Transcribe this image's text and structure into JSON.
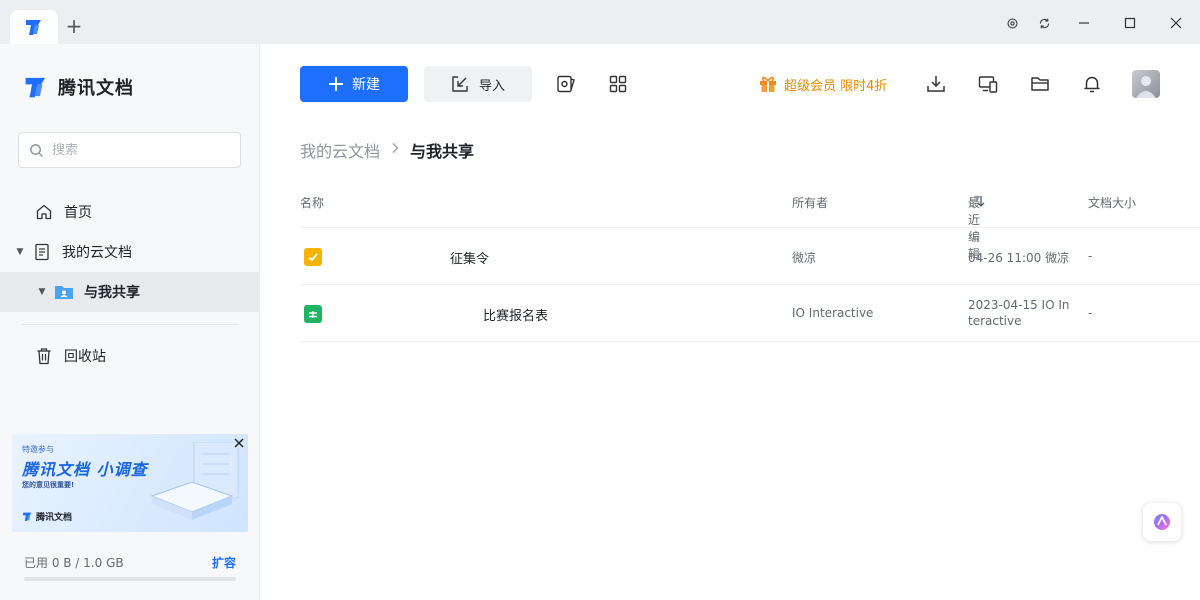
{
  "app": {
    "name": "腾讯文档"
  },
  "sidebar": {
    "search_placeholder": "搜索",
    "items": [
      {
        "label": "首页"
      },
      {
        "label": "我的云文档"
      },
      {
        "label": "与我共享"
      },
      {
        "label": "回收站"
      }
    ],
    "banner": {
      "small_text": "特邀参与",
      "title": "腾讯文档 小调查",
      "subtitle": "您的意见很重要!",
      "logo_text": "腾讯文档"
    },
    "storage": {
      "used_text": "已用 0 B / 1.0 GB",
      "expand_label": "扩容",
      "used_fraction": 0
    }
  },
  "toolbar": {
    "new_label": "新建",
    "import_label": "导入",
    "vip_text": "超级会员 限时4折"
  },
  "breadcrumb": {
    "parent": "我的云文档",
    "current": "与我共享"
  },
  "table": {
    "headers": {
      "name": "名称",
      "owner": "所有者",
      "recent": "最近编辑",
      "size": "文档大小"
    },
    "rows": [
      {
        "name": "征集令",
        "owner": "微凉",
        "recent": "04-26 11:00 微凉",
        "size": "-",
        "icon": "form-doc-icon",
        "color": "#f5b400"
      },
      {
        "name": "比赛报名表",
        "owner": "IO Interactive",
        "recent_line1": "2023-04-15 IO In",
        "recent_line2": "teractive",
        "size": "-",
        "icon": "sheet-doc-icon",
        "color": "#1fb364"
      }
    ]
  },
  "colors": {
    "accent": "#1e6fff",
    "vip": "#e68a00"
  }
}
